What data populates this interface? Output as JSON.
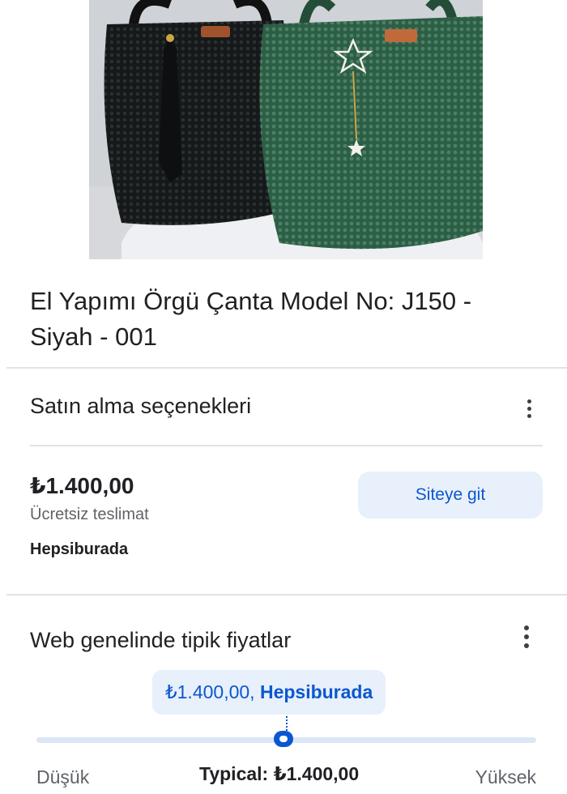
{
  "product": {
    "title": "El Yapımı Örgü Çanta Model No: J150 - Siyah - 001"
  },
  "purchase_options": {
    "heading": "Satın alma seçenekleri",
    "price": "₺1.400,00",
    "shipping": "Ücretsiz teslimat",
    "seller": "Hepsiburada",
    "visit_button": "Siteye git"
  },
  "typical_prices": {
    "heading": "Web genelinde tipik fiyatlar",
    "bubble_price": "₺1.400,00,",
    "bubble_seller": "Hepsiburada",
    "range_low_label": "Düşük",
    "range_high_label": "Yüksek",
    "typical_label": "Typical: ₺1.400,00",
    "slider_position_fraction": 0.5
  },
  "icons": {
    "options_menu": "more-vert-icon"
  },
  "colors": {
    "accent": "#0b57d0",
    "accent_bg": "#e8f0fb",
    "divider": "#e2e3e5"
  }
}
